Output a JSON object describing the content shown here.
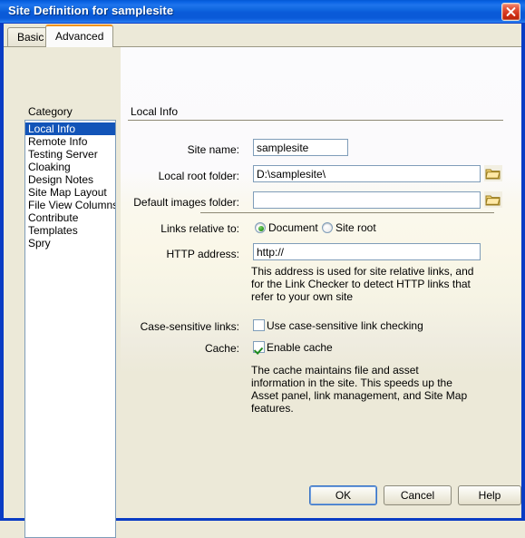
{
  "window": {
    "title": "Site Definition for samplesite",
    "close_icon": "close-icon"
  },
  "tabs": [
    {
      "label": "Basic",
      "active": false
    },
    {
      "label": "Advanced",
      "active": true
    }
  ],
  "sidebar": {
    "heading": "Category",
    "items": [
      {
        "label": "Local Info",
        "selected": true
      },
      {
        "label": "Remote Info",
        "selected": false
      },
      {
        "label": "Testing Server",
        "selected": false
      },
      {
        "label": "Cloaking",
        "selected": false
      },
      {
        "label": "Design Notes",
        "selected": false
      },
      {
        "label": "Site Map Layout",
        "selected": false
      },
      {
        "label": "File View Columns",
        "selected": false
      },
      {
        "label": "Contribute",
        "selected": false
      },
      {
        "label": "Templates",
        "selected": false
      },
      {
        "label": "Spry",
        "selected": false
      }
    ]
  },
  "main": {
    "section_title": "Local Info",
    "fields": {
      "site_name_label": "Site name:",
      "site_name_value": "samplesite",
      "local_root_label": "Local root folder:",
      "local_root_value": "D:\\samplesite\\",
      "default_images_label": "Default images folder:",
      "default_images_value": "",
      "links_relative_label": "Links relative to:",
      "radio_document": "Document",
      "radio_site_root": "Site root",
      "http_address_label": "HTTP address:",
      "http_address_value": "http://",
      "http_help": "This address is used for site relative links, and for the Link Checker to detect HTTP links that refer to your own site",
      "case_sensitive_label": "Case-sensitive links:",
      "case_sensitive_checkbox": "Use case-sensitive link checking",
      "cache_label": "Cache:",
      "cache_checkbox": "Enable cache",
      "cache_help": "The cache maintains file and asset information in the site.  This speeds up the Asset panel, link management, and Site Map features."
    },
    "browse_icon": "folder-icon"
  },
  "footer": {
    "ok": "OK",
    "cancel": "Cancel",
    "help": "Help"
  },
  "colors": {
    "titlebar_blue": "#0a5ad8",
    "frame_blue": "#0a3cc4",
    "selection_blue": "#1254b8",
    "active_tab_accent": "#f0921e",
    "dialog_face": "#ece9d8"
  }
}
